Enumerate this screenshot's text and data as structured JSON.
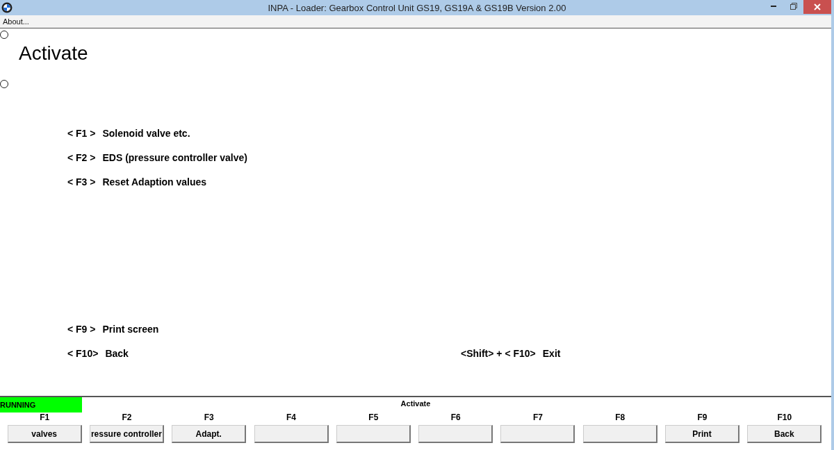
{
  "window": {
    "title": "INPA - Loader:  Gearbox Control Unit GS19, GS19A & GS19B Version 2.00"
  },
  "menu": [
    "About..."
  ],
  "heading": "Activate",
  "options": [
    {
      "key": "< F1 >",
      "label": "Solenoid valve etc."
    },
    {
      "key": "< F2 >",
      "label": "EDS (pressure controller valve)"
    },
    {
      "key": "< F3 >",
      "label": "Reset Adaption values"
    }
  ],
  "footer_options": [
    {
      "key": "< F9 >",
      "label": "Print screen"
    }
  ],
  "last_row": [
    {
      "key": "< F10>",
      "label": "Back"
    },
    {
      "key": "<Shift> + < F10>",
      "label": "Exit"
    }
  ],
  "status": {
    "state": "RUNNING",
    "screen": "Activate"
  },
  "function_keys": [
    {
      "key": "F1",
      "label": "valves"
    },
    {
      "key": "F2",
      "label": "ressure controller"
    },
    {
      "key": "F3",
      "label": "Adapt."
    },
    {
      "key": "F4"
    },
    {
      "key": "F5"
    },
    {
      "key": "F6"
    },
    {
      "key": "F7"
    },
    {
      "key": "F8"
    },
    {
      "key": "F9",
      "label": "Print"
    },
    {
      "key": "F10",
      "label": "Back"
    }
  ]
}
